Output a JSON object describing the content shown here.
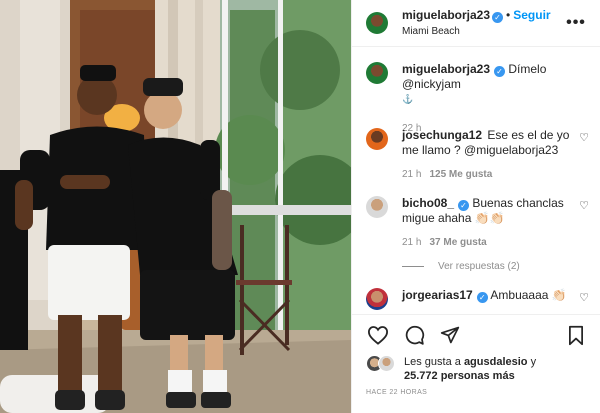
{
  "post": {
    "author": "miguelaborja23",
    "follow_label": "Seguir",
    "location": "Miami Beach",
    "separator": "•",
    "more_label": "•••"
  },
  "caption": {
    "author": "miguelaborja23",
    "text": "Dímelo @nickyjam",
    "emoji": "⚓",
    "time": "22 h"
  },
  "comments": [
    {
      "author": "josechunga12",
      "text": "Ese es el de yo me llamo ? @miguelaborja23",
      "time": "21 h",
      "likes": "125 Me gusta",
      "verified": false
    },
    {
      "author": "bicho08_",
      "text": "Buenas chanclas migue ahaha 👏🏻👏🏻",
      "time": "21 h",
      "likes": "37 Me gusta",
      "verified": true,
      "view_replies": "Ver respuestas (2)"
    },
    {
      "author": "jorgearias17",
      "text": "Ambuaaaa 👏🏻",
      "verified": true
    }
  ],
  "footer": {
    "likes_prefix": "Les gusta a",
    "likes_user": "agusdalesio",
    "likes_conj": "y",
    "likes_count": "25.772 personas más",
    "time_ago": "HACE 22 HORAS"
  },
  "icons": {
    "heart": "heart-icon",
    "comment": "comment-icon",
    "share": "share-icon",
    "save": "bookmark-icon",
    "verified": "verified-badge-icon"
  },
  "colors": {
    "accent": "#0095f6",
    "verified": "#3897f0",
    "muted": "#8e8e8e"
  }
}
